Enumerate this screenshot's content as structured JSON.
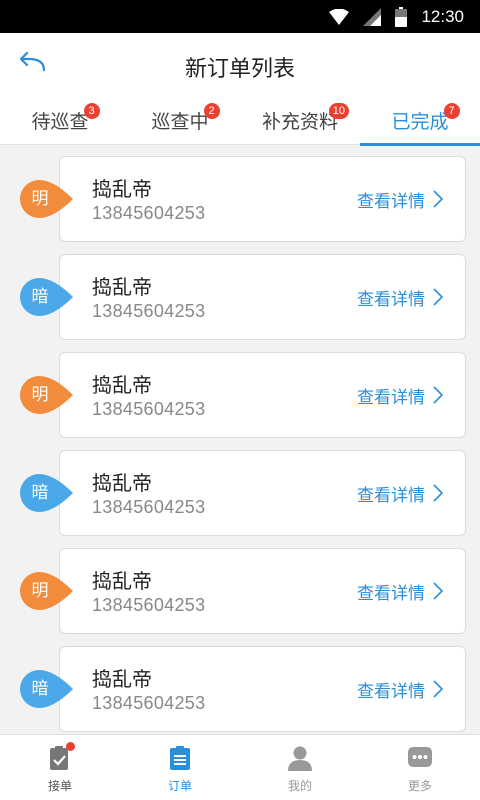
{
  "status_bar": {
    "time": "12:30"
  },
  "header": {
    "title": "新订单列表"
  },
  "tabs": [
    {
      "label": "待巡查",
      "badge": "3"
    },
    {
      "label": "巡查中",
      "badge": "2"
    },
    {
      "label": "补充资料",
      "badge": "10"
    },
    {
      "label": "已完成",
      "badge": "7",
      "active": true
    }
  ],
  "orders": [
    {
      "tag": "明",
      "tag_color": "#f28c3c",
      "name": "捣乱帝",
      "phone": "13845604253",
      "action": "查看详情"
    },
    {
      "tag": "暗",
      "tag_color": "#4aa8e8",
      "name": "捣乱帝",
      "phone": "13845604253",
      "action": "查看详情"
    },
    {
      "tag": "明",
      "tag_color": "#f28c3c",
      "name": "捣乱帝",
      "phone": "13845604253",
      "action": "查看详情"
    },
    {
      "tag": "暗",
      "tag_color": "#4aa8e8",
      "name": "捣乱帝",
      "phone": "13845604253",
      "action": "查看详情"
    },
    {
      "tag": "明",
      "tag_color": "#f28c3c",
      "name": "捣乱帝",
      "phone": "13845604253",
      "action": "查看详情"
    },
    {
      "tag": "暗",
      "tag_color": "#4aa8e8",
      "name": "捣乱帝",
      "phone": "13845604253",
      "action": "查看详情"
    }
  ],
  "bottom_nav": [
    {
      "label": "接单",
      "icon": "clipboard-check-icon",
      "has_dot": true
    },
    {
      "label": "订单",
      "icon": "order-list-icon",
      "active": true
    },
    {
      "label": "我的",
      "icon": "user-icon"
    },
    {
      "label": "更多",
      "icon": "more-chat-icon"
    }
  ],
  "colors": {
    "accent": "#2a8fd8",
    "badge": "#e8412f",
    "light_tag": "#f28c3c",
    "dark_tag": "#4aa8e8"
  }
}
